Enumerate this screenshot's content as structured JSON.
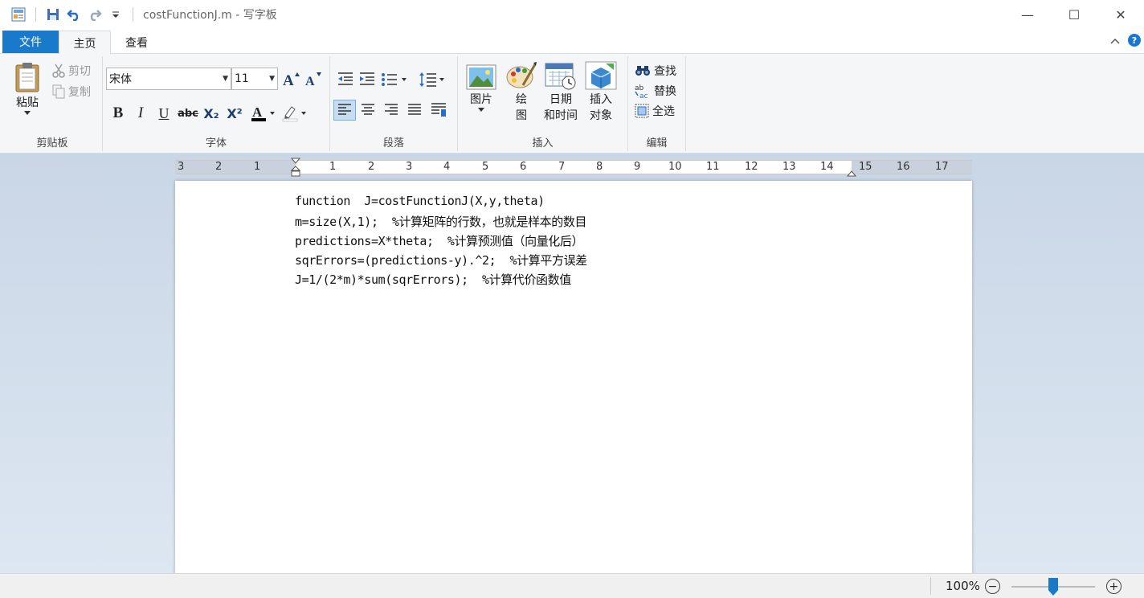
{
  "titlebar": {
    "doc_title": "costFunctionJ.m - 写字板",
    "minimize_glyph": "—",
    "maximize_glyph": "☐",
    "close_glyph": "✕"
  },
  "tabs": {
    "file": "文件",
    "home": "主页",
    "view": "查看"
  },
  "clipboard": {
    "paste": "粘贴",
    "cut": "剪切",
    "copy": "复制",
    "label": "剪贴板"
  },
  "font": {
    "family_value": "宋体",
    "size_value": "11",
    "label": "字体",
    "bold": "B",
    "italic": "I",
    "underline": "U",
    "strike": "abc",
    "subscript": "X₂",
    "superscript": "X²"
  },
  "paragraph": {
    "label": "段落"
  },
  "insert": {
    "picture": "图片",
    "paint_line1": "绘",
    "paint_line2": "图",
    "datetime_line1": "日期",
    "datetime_line2": "和时间",
    "object_line1": "插入",
    "object_line2": "对象",
    "label": "插入"
  },
  "editing": {
    "find": "查找",
    "replace": "替换",
    "select_all": "全选",
    "label": "编辑"
  },
  "ruler": {
    "labels": [
      "3",
      "2",
      "1",
      "1",
      "2",
      "3",
      "4",
      "5",
      "6",
      "7",
      "8",
      "9",
      "10",
      "11",
      "12",
      "13",
      "14",
      "15",
      "16",
      "17"
    ]
  },
  "document": {
    "lines": [
      "function  J=costFunctionJ(X,y,theta)",
      "m=size(X,1);  %计算矩阵的行数，也就是样本的数目",
      "predictions=X*theta;  %计算预测值（向量化后）",
      "sqrErrors=(predictions-y).^2;  %计算平方误差",
      "J=1/(2*m)*sum(sqrErrors);  %计算代价函数值"
    ]
  },
  "status": {
    "zoom": "100%",
    "zoom_out": "−",
    "zoom_in": "+"
  },
  "colors": {
    "accent": "#1979ca",
    "ribbon_bg": "#f5f6f7",
    "workspace_bg": "#c9d6e6"
  }
}
